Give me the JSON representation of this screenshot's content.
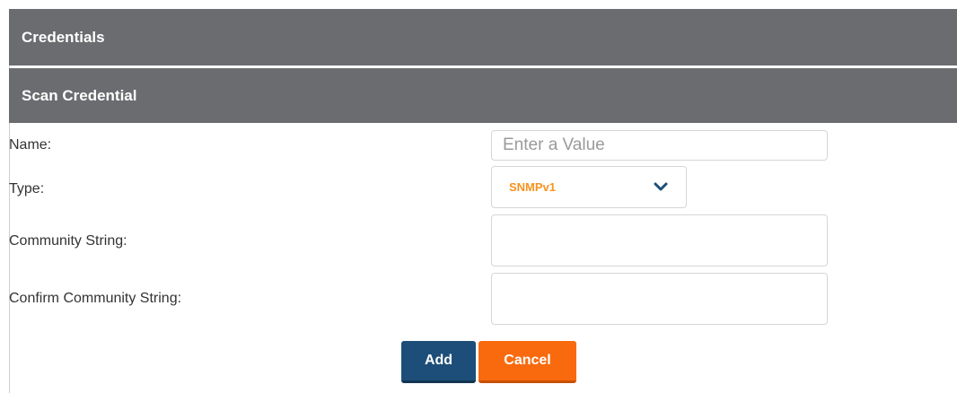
{
  "panel": {
    "title": "Credentials",
    "subtitle": "Scan Credential"
  },
  "form": {
    "name_label": "Name:",
    "name_placeholder": "Enter a Value",
    "name_value": "",
    "type_label": "Type:",
    "type_value": "SNMPv1",
    "community_label": "Community String:",
    "community_value": "",
    "confirm_label": "Confirm Community String:",
    "confirm_value": ""
  },
  "actions": {
    "add_label": "Add",
    "cancel_label": "Cancel"
  },
  "icons": {
    "type_dropdown": "chevron-down-icon"
  },
  "colors": {
    "header_bg": "#6b6c6f",
    "type_value": "#f7931e",
    "add_button": "#1d4e79",
    "cancel_button": "#f96a0e"
  }
}
